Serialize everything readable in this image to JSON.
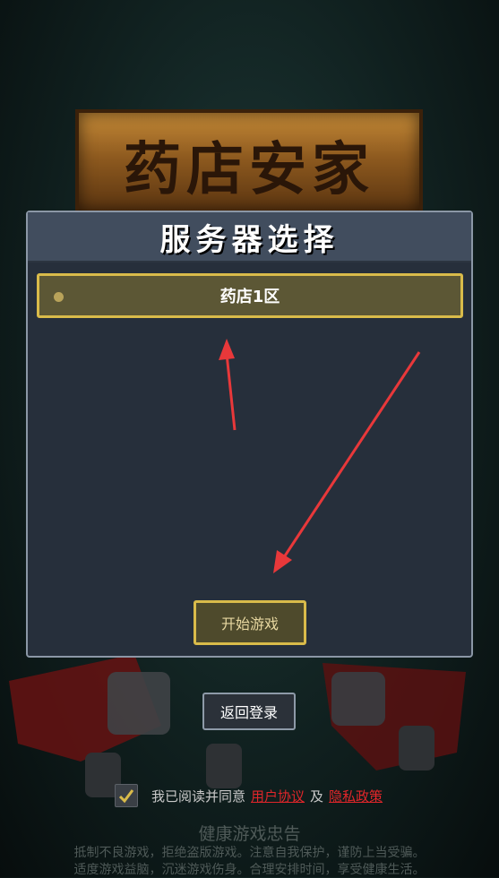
{
  "background": {
    "sign_title": "药店安家"
  },
  "dialog": {
    "title": "服务器选择",
    "servers": [
      {
        "label": "药店1区",
        "selected": true
      }
    ],
    "start_label": "开始游戏"
  },
  "back_label": "返回登录",
  "agreement": {
    "checked": true,
    "prefix": "我已阅读并同意",
    "user_agreement": "用户协议",
    "and": "及",
    "privacy_policy": "隐私政策"
  },
  "health_advice": {
    "title": "健康游戏忠告",
    "line1": "抵制不良游戏，拒绝盗版游戏。注意自我保护，谨防上当受骗。",
    "line2": "适度游戏益脑，沉迷游戏伤身。合理安排时间，享受健康生活。"
  },
  "colors": {
    "accent_gold": "#d9bb4a",
    "link_red": "#e0262a",
    "annotation_arrow": "#e8383a"
  }
}
